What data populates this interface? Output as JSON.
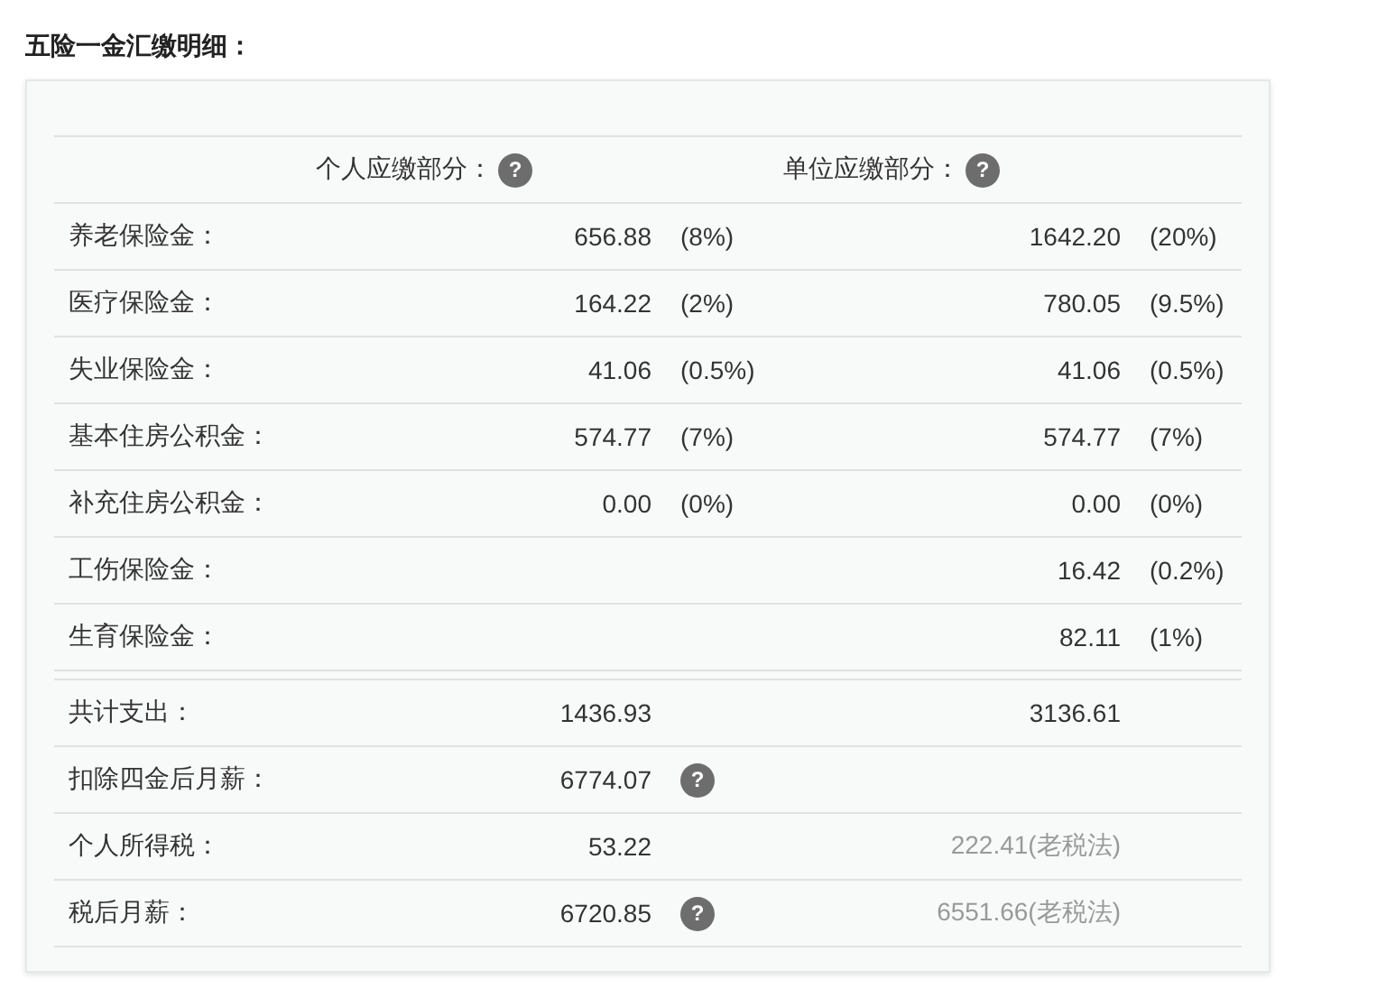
{
  "title": "五险一金汇缴明细：",
  "headers": [
    {
      "label": "个人应缴部分：",
      "help": "?"
    },
    {
      "label": "单位应缴部分：",
      "help": "?"
    }
  ],
  "items": [
    {
      "label": "养老保险金：",
      "personal": "656.88",
      "personal_rate": "(8%)",
      "company": "1642.20",
      "company_rate": "(20%)"
    },
    {
      "label": "医疗保险金：",
      "personal": "164.22",
      "personal_rate": "(2%)",
      "company": "780.05",
      "company_rate": "(9.5%)"
    },
    {
      "label": "失业保险金：",
      "personal": "41.06",
      "personal_rate": "(0.5%)",
      "company": "41.06",
      "company_rate": "(0.5%)"
    },
    {
      "label": "基本住房公积金：",
      "personal": "574.77",
      "personal_rate": "(7%)",
      "company": "574.77",
      "company_rate": "(7%)"
    },
    {
      "label": "补充住房公积金：",
      "personal": "0.00",
      "personal_rate": "(0%)",
      "company": "0.00",
      "company_rate": "(0%)"
    },
    {
      "label": "工伤保险金：",
      "company": "16.42",
      "company_rate": "(0.2%)"
    },
    {
      "label": "生育保险金：",
      "company": "82.11",
      "company_rate": "(1%)"
    }
  ],
  "summary": [
    {
      "label": "共计支出：",
      "personal": "1436.93",
      "company": "3136.61",
      "muted": false
    },
    {
      "label": "扣除四金后月薪：",
      "personal": "6774.07",
      "help": "?"
    },
    {
      "label": "个人所得税：",
      "personal": "53.22",
      "company": "222.41(老税法)",
      "muted": true
    },
    {
      "label": "税后月薪：",
      "personal": "6720.85",
      "help": "?",
      "company": "6551.66(老税法)",
      "muted": true
    }
  ]
}
